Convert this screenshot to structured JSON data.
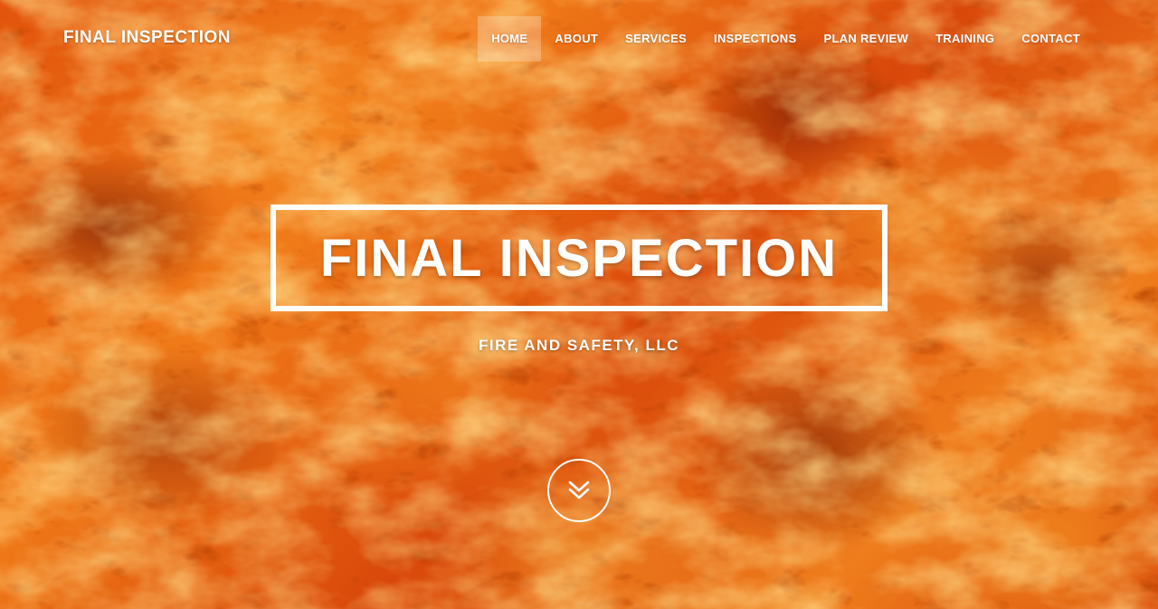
{
  "header": {
    "brand": "FINAL INSPECTION"
  },
  "nav": {
    "items": [
      {
        "label": "HOME",
        "active": true
      },
      {
        "label": "ABOUT"
      },
      {
        "label": "SERVICES"
      },
      {
        "label": "INSPECTIONS"
      },
      {
        "label": "PLAN REVIEW"
      },
      {
        "label": "TRAINING"
      },
      {
        "label": "CONTACT"
      }
    ]
  },
  "hero": {
    "title": "FINAL INSPECTION",
    "subtitle": "FIRE AND SAFETY, LLC",
    "scroll_icon": "double-chevron-down-icon"
  },
  "colors": {
    "text": "#ffffff",
    "fire_primary": "#e2540c",
    "fire_highlight": "#f5a030",
    "fire_dark": "#8a1a02",
    "nav_active_bg": "rgba(255,255,255,0.25)"
  }
}
